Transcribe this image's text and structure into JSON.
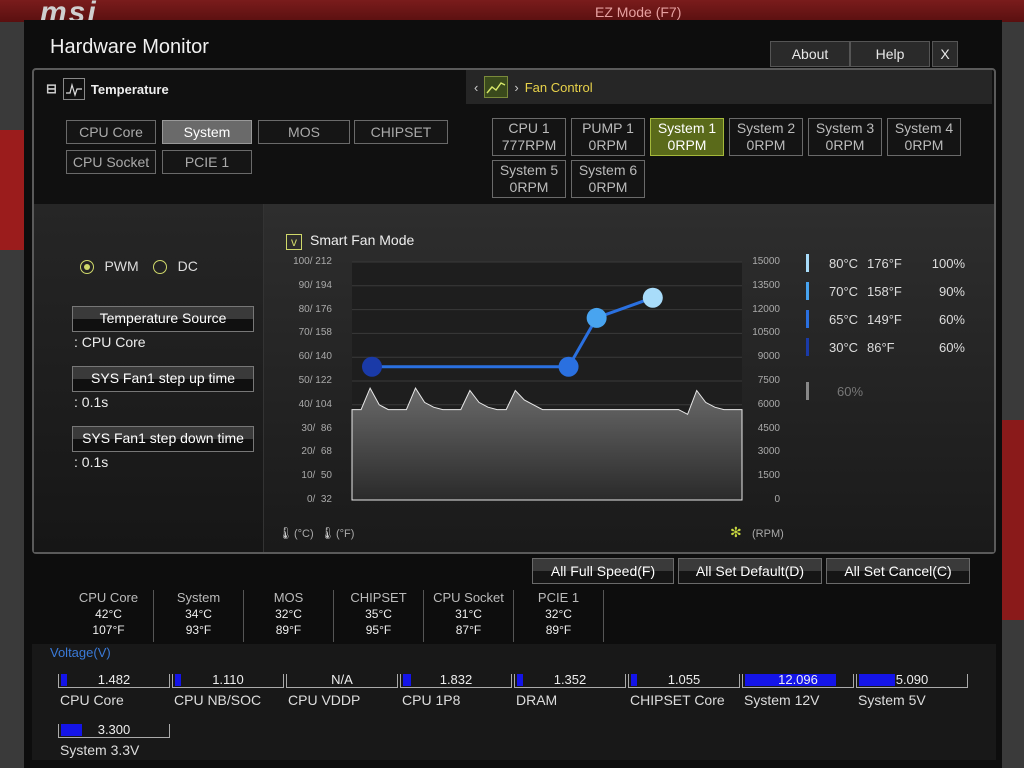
{
  "window": {
    "title": "Hardware Monitor",
    "about": "About",
    "help": "Help",
    "close": "X"
  },
  "background": {
    "brand": "msi",
    "ez_mode": "EZ Mode (F7)"
  },
  "tabs": {
    "temperature": "Temperature",
    "fan_control": "Fan Control"
  },
  "temp_sources": [
    {
      "label": "CPU Core",
      "active": false
    },
    {
      "label": "System",
      "active": true
    },
    {
      "label": "MOS",
      "active": false
    },
    {
      "label": "CHIPSET",
      "active": false
    },
    {
      "label": "CPU Socket",
      "active": false
    },
    {
      "label": "PCIE 1",
      "active": false
    }
  ],
  "fans": [
    {
      "name": "CPU 1",
      "rpm": "777RPM",
      "active": false
    },
    {
      "name": "PUMP 1",
      "rpm": "0RPM",
      "active": false
    },
    {
      "name": "System 1",
      "rpm": "0RPM",
      "active": true
    },
    {
      "name": "System 2",
      "rpm": "0RPM",
      "active": false
    },
    {
      "name": "System 3",
      "rpm": "0RPM",
      "active": false
    },
    {
      "name": "System 4",
      "rpm": "0RPM",
      "active": false
    },
    {
      "name": "System 5",
      "rpm": "0RPM",
      "active": false
    },
    {
      "name": "System 6",
      "rpm": "0RPM",
      "active": false
    }
  ],
  "mode": {
    "pwm": "PWM",
    "dc": "DC",
    "selected": "PWM"
  },
  "settings": {
    "temp_source_label": "Temperature Source",
    "temp_source_value": ": CPU Core",
    "step_up_label": "SYS Fan1 step up time",
    "step_up_value": ": 0.1s",
    "step_down_label": "SYS Fan1 step down time",
    "step_down_value": ": 0.1s"
  },
  "smart_fan": {
    "label": "Smart Fan Mode",
    "checked": true,
    "check_glyph": "v"
  },
  "chart_data": {
    "type": "line",
    "y_left_ticks": [
      "100/ 212",
      "90/ 194",
      "80/ 176",
      "70/ 158",
      "60/ 140",
      "50/ 122",
      "40/ 104",
      "30/  86",
      "20/  68",
      "10/  50",
      "0/  32"
    ],
    "y_right_ticks": [
      "15000",
      "13500",
      "12000",
      "10500",
      "9000",
      "7500",
      "6000",
      "4500",
      "3000",
      "1500",
      "0"
    ],
    "left_unit_c": "(°C)",
    "left_unit_f": "(°F)",
    "right_unit": "(RPM)",
    "fan_curve": [
      {
        "temp_c": 30,
        "fan_pct": 60
      },
      {
        "temp_c": 65,
        "fan_pct": 60
      },
      {
        "temp_c": 70,
        "fan_pct": 90
      },
      {
        "temp_c": 80,
        "fan_pct": 100
      }
    ],
    "temp_trace_c": [
      38,
      38,
      47,
      40,
      38,
      38,
      38,
      47,
      41,
      39,
      38,
      38,
      38,
      46,
      41,
      39,
      38,
      38,
      46,
      42,
      40,
      38,
      38,
      38,
      38,
      38,
      38,
      38,
      38,
      38,
      38,
      38,
      38,
      38,
      38,
      38,
      38,
      36,
      46,
      41,
      39,
      38,
      38,
      38
    ],
    "ylim_c": [
      0,
      100
    ],
    "ylim_rpm": [
      0,
      15000
    ],
    "colors": [
      "#1a3aa8",
      "#2a70e0",
      "#48a4f0",
      "#a8dcfa"
    ]
  },
  "legend": [
    {
      "c": "80°C",
      "f": "176°F",
      "pct": "100%",
      "color": "#a8dcfa"
    },
    {
      "c": "70°C",
      "f": "158°F",
      "pct": "90%",
      "color": "#48a4f0"
    },
    {
      "c": "65°C",
      "f": "149°F",
      "pct": "60%",
      "color": "#2a70e0"
    },
    {
      "c": "30°C",
      "f": "86°F",
      "pct": "60%",
      "color": "#1a3aa8"
    }
  ],
  "current_pct": "60%",
  "actions": {
    "full_speed": "All Full Speed(F)",
    "set_default": "All Set Default(D)",
    "set_cancel": "All Set Cancel(C)"
  },
  "temps": [
    {
      "name": "CPU Core",
      "c": "42°C",
      "f": "107°F"
    },
    {
      "name": "System",
      "c": "34°C",
      "f": "93°F"
    },
    {
      "name": "MOS",
      "c": "32°C",
      "f": "89°F"
    },
    {
      "name": "CHIPSET",
      "c": "35°C",
      "f": "95°F"
    },
    {
      "name": "CPU Socket",
      "c": "31°C",
      "f": "87°F"
    },
    {
      "name": "PCIE 1",
      "c": "32°C",
      "f": "89°F"
    }
  ],
  "voltage_title": "Voltage(V)",
  "voltages": [
    {
      "name": "CPU Core",
      "value": "1.482",
      "fill": 0.06
    },
    {
      "name": "CPU NB/SOC",
      "value": "1.110",
      "fill": 0.05
    },
    {
      "name": "CPU VDDP",
      "value": "N/A",
      "fill": 0
    },
    {
      "name": "CPU 1P8",
      "value": "1.832",
      "fill": 0.08
    },
    {
      "name": "DRAM",
      "value": "1.352",
      "fill": 0.06
    },
    {
      "name": "CHIPSET Core",
      "value": "1.055",
      "fill": 0.05
    },
    {
      "name": "System 12V",
      "value": "12.096",
      "fill": 0.86
    },
    {
      "name": "System 5V",
      "value": "5.090",
      "fill": 0.34
    },
    {
      "name": "System 3.3V",
      "value": "3.300",
      "fill": 0.2
    }
  ]
}
